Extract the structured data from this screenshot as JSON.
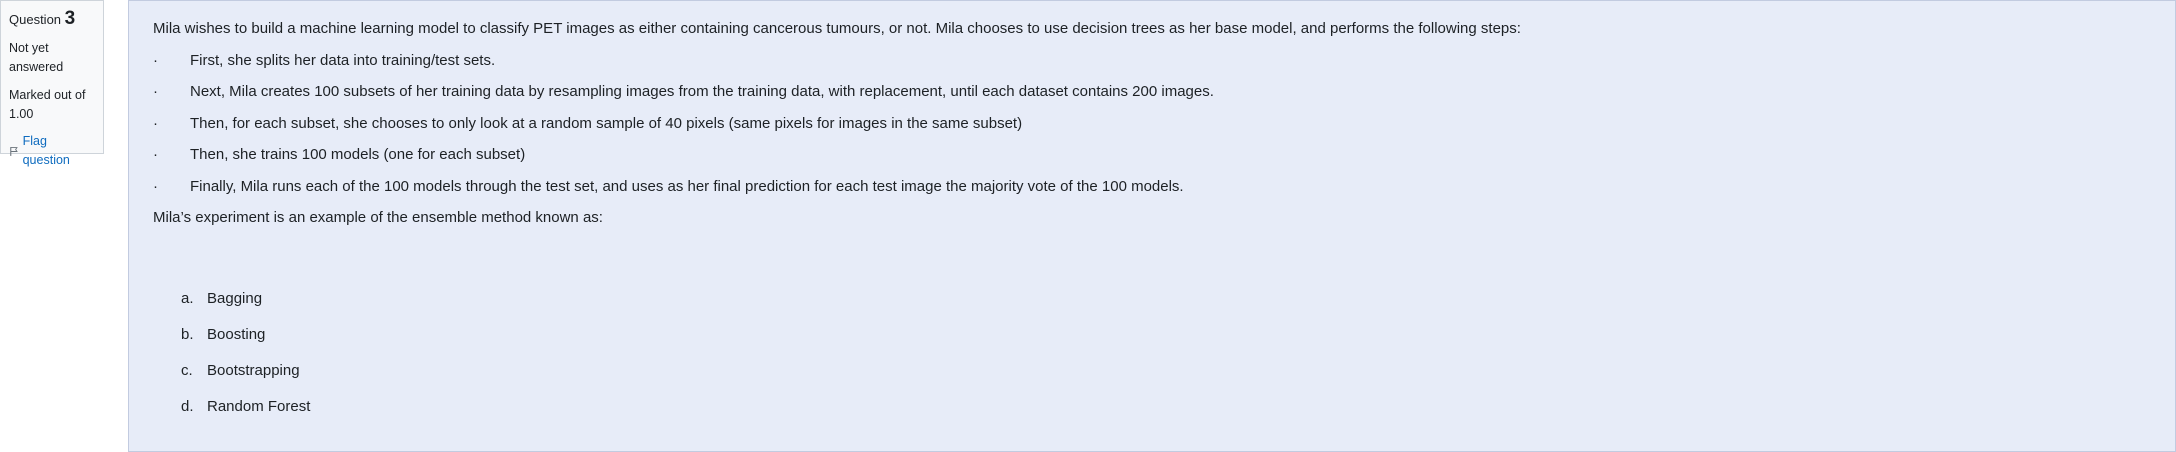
{
  "info": {
    "question_label": "Question",
    "question_number": "3",
    "state": "Not yet answered",
    "grade": "Marked out of 1.00",
    "flag_label": "Flag question"
  },
  "question": {
    "intro": "Mila wishes to build a machine learning model to classify PET images as either containing cancerous tumours, or not. Mila chooses to use decision trees as her base model, and performs the following steps:",
    "bullet_symbol": "·",
    "steps": [
      "First, she splits her data into training/test sets.",
      "Next, Mila creates 100 subsets of her training data by resampling images from the training data, with replacement, until each dataset contains 200 images.",
      "Then, for each subset, she chooses to only look at a random sample of 40 pixels (same pixels for images in the same subset)",
      "Then, she trains 100 models (one for each subset)",
      "Finally, Mila runs each of the 100 models through the test set, and uses as her final prediction for each test image the majority vote of the 100 models."
    ],
    "prompt": "Mila’s experiment is an example of the ensemble method known as:"
  },
  "answers": [
    {
      "letter": "a.",
      "text": "Bagging"
    },
    {
      "letter": "b.",
      "text": "Boosting"
    },
    {
      "letter": "c.",
      "text": "Bootstrapping"
    },
    {
      "letter": "d.",
      "text": "Random Forest"
    }
  ]
}
